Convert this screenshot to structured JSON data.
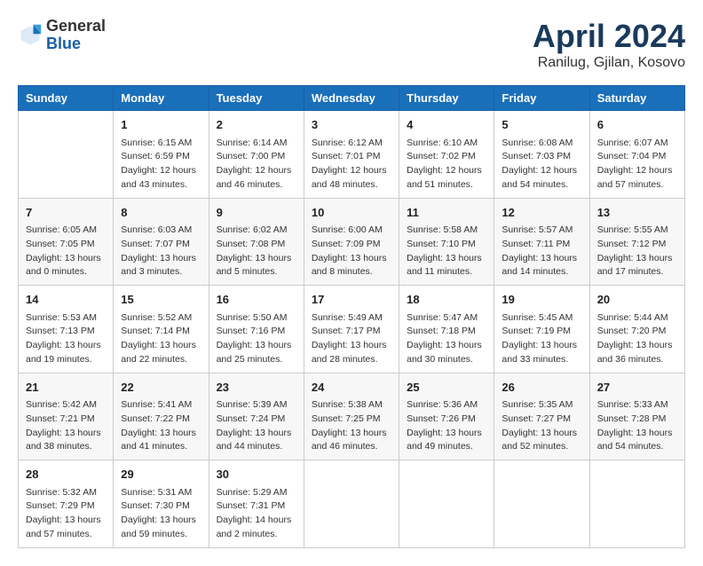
{
  "header": {
    "logo_general": "General",
    "logo_blue": "Blue",
    "title": "April 2024",
    "subtitle": "Ranilug, Gjilan, Kosovo"
  },
  "weekdays": [
    "Sunday",
    "Monday",
    "Tuesday",
    "Wednesday",
    "Thursday",
    "Friday",
    "Saturday"
  ],
  "weeks": [
    [
      {
        "day": "",
        "text": ""
      },
      {
        "day": "1",
        "text": "Sunrise: 6:15 AM\nSunset: 6:59 PM\nDaylight: 12 hours\nand 43 minutes."
      },
      {
        "day": "2",
        "text": "Sunrise: 6:14 AM\nSunset: 7:00 PM\nDaylight: 12 hours\nand 46 minutes."
      },
      {
        "day": "3",
        "text": "Sunrise: 6:12 AM\nSunset: 7:01 PM\nDaylight: 12 hours\nand 48 minutes."
      },
      {
        "day": "4",
        "text": "Sunrise: 6:10 AM\nSunset: 7:02 PM\nDaylight: 12 hours\nand 51 minutes."
      },
      {
        "day": "5",
        "text": "Sunrise: 6:08 AM\nSunset: 7:03 PM\nDaylight: 12 hours\nand 54 minutes."
      },
      {
        "day": "6",
        "text": "Sunrise: 6:07 AM\nSunset: 7:04 PM\nDaylight: 12 hours\nand 57 minutes."
      }
    ],
    [
      {
        "day": "7",
        "text": "Sunrise: 6:05 AM\nSunset: 7:05 PM\nDaylight: 13 hours\nand 0 minutes."
      },
      {
        "day": "8",
        "text": "Sunrise: 6:03 AM\nSunset: 7:07 PM\nDaylight: 13 hours\nand 3 minutes."
      },
      {
        "day": "9",
        "text": "Sunrise: 6:02 AM\nSunset: 7:08 PM\nDaylight: 13 hours\nand 5 minutes."
      },
      {
        "day": "10",
        "text": "Sunrise: 6:00 AM\nSunset: 7:09 PM\nDaylight: 13 hours\nand 8 minutes."
      },
      {
        "day": "11",
        "text": "Sunrise: 5:58 AM\nSunset: 7:10 PM\nDaylight: 13 hours\nand 11 minutes."
      },
      {
        "day": "12",
        "text": "Sunrise: 5:57 AM\nSunset: 7:11 PM\nDaylight: 13 hours\nand 14 minutes."
      },
      {
        "day": "13",
        "text": "Sunrise: 5:55 AM\nSunset: 7:12 PM\nDaylight: 13 hours\nand 17 minutes."
      }
    ],
    [
      {
        "day": "14",
        "text": "Sunrise: 5:53 AM\nSunset: 7:13 PM\nDaylight: 13 hours\nand 19 minutes."
      },
      {
        "day": "15",
        "text": "Sunrise: 5:52 AM\nSunset: 7:14 PM\nDaylight: 13 hours\nand 22 minutes."
      },
      {
        "day": "16",
        "text": "Sunrise: 5:50 AM\nSunset: 7:16 PM\nDaylight: 13 hours\nand 25 minutes."
      },
      {
        "day": "17",
        "text": "Sunrise: 5:49 AM\nSunset: 7:17 PM\nDaylight: 13 hours\nand 28 minutes."
      },
      {
        "day": "18",
        "text": "Sunrise: 5:47 AM\nSunset: 7:18 PM\nDaylight: 13 hours\nand 30 minutes."
      },
      {
        "day": "19",
        "text": "Sunrise: 5:45 AM\nSunset: 7:19 PM\nDaylight: 13 hours\nand 33 minutes."
      },
      {
        "day": "20",
        "text": "Sunrise: 5:44 AM\nSunset: 7:20 PM\nDaylight: 13 hours\nand 36 minutes."
      }
    ],
    [
      {
        "day": "21",
        "text": "Sunrise: 5:42 AM\nSunset: 7:21 PM\nDaylight: 13 hours\nand 38 minutes."
      },
      {
        "day": "22",
        "text": "Sunrise: 5:41 AM\nSunset: 7:22 PM\nDaylight: 13 hours\nand 41 minutes."
      },
      {
        "day": "23",
        "text": "Sunrise: 5:39 AM\nSunset: 7:24 PM\nDaylight: 13 hours\nand 44 minutes."
      },
      {
        "day": "24",
        "text": "Sunrise: 5:38 AM\nSunset: 7:25 PM\nDaylight: 13 hours\nand 46 minutes."
      },
      {
        "day": "25",
        "text": "Sunrise: 5:36 AM\nSunset: 7:26 PM\nDaylight: 13 hours\nand 49 minutes."
      },
      {
        "day": "26",
        "text": "Sunrise: 5:35 AM\nSunset: 7:27 PM\nDaylight: 13 hours\nand 52 minutes."
      },
      {
        "day": "27",
        "text": "Sunrise: 5:33 AM\nSunset: 7:28 PM\nDaylight: 13 hours\nand 54 minutes."
      }
    ],
    [
      {
        "day": "28",
        "text": "Sunrise: 5:32 AM\nSunset: 7:29 PM\nDaylight: 13 hours\nand 57 minutes."
      },
      {
        "day": "29",
        "text": "Sunrise: 5:31 AM\nSunset: 7:30 PM\nDaylight: 13 hours\nand 59 minutes."
      },
      {
        "day": "30",
        "text": "Sunrise: 5:29 AM\nSunset: 7:31 PM\nDaylight: 14 hours\nand 2 minutes."
      },
      {
        "day": "",
        "text": ""
      },
      {
        "day": "",
        "text": ""
      },
      {
        "day": "",
        "text": ""
      },
      {
        "day": "",
        "text": ""
      }
    ]
  ]
}
